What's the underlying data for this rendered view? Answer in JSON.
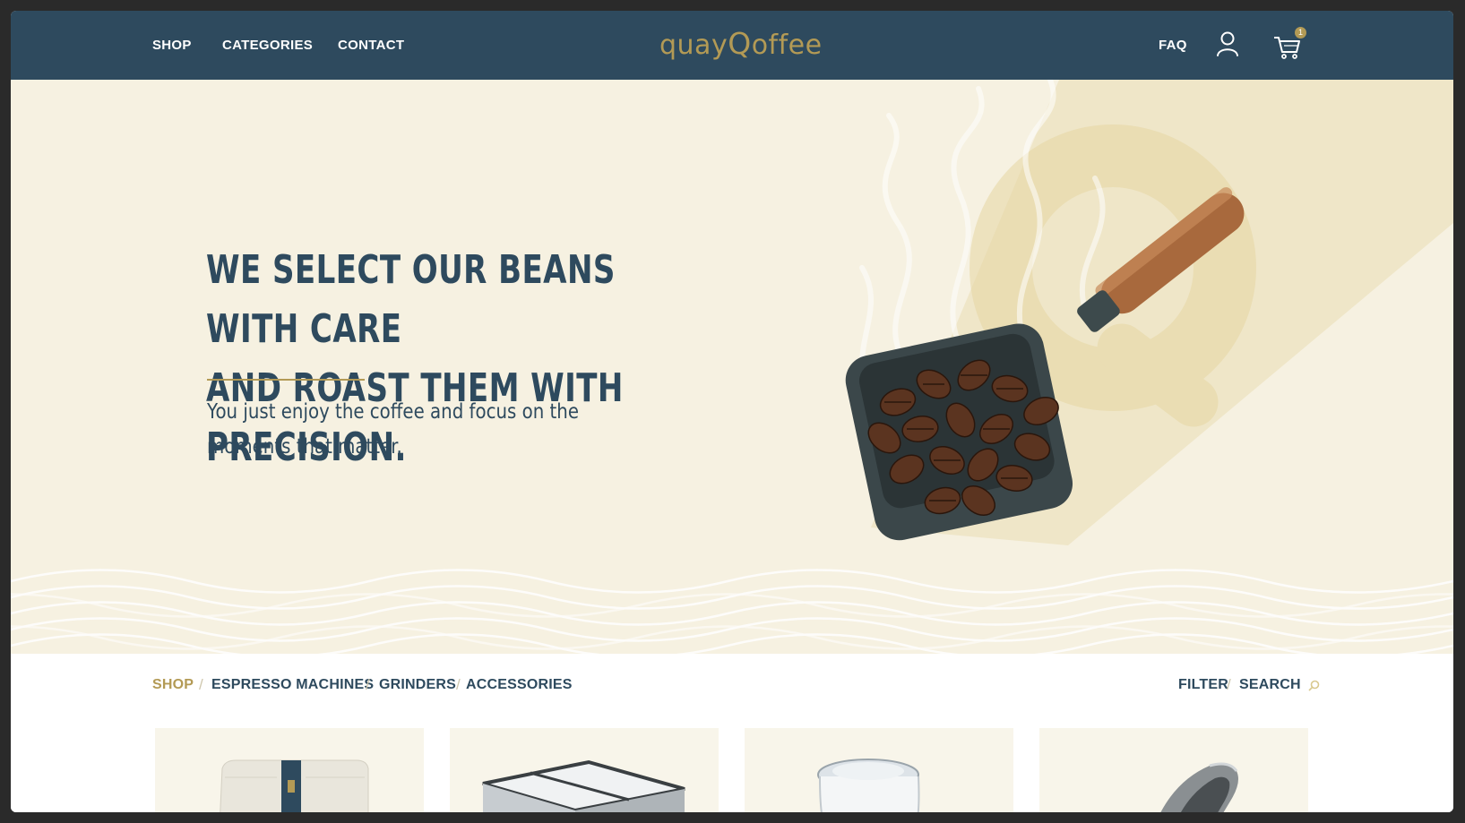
{
  "colors": {
    "navy": "#2e4a5e",
    "gold": "#b39a55",
    "cream": "#f6f1e1"
  },
  "header": {
    "nav": {
      "shop": "SHOP",
      "categories": "CATEGORIES",
      "contact": "CONTACT",
      "faq": "FAQ"
    },
    "logo": {
      "prefix": "quay",
      "mark": "Q",
      "suffix": "offee"
    },
    "icons": {
      "account": "user-icon",
      "cart": "cart-icon"
    },
    "cart_count": "1"
  },
  "hero": {
    "title_line1": "WE SELECT OUR BEANS WITH CARE",
    "title_line2": "AND ROAST THEM WITH PRECISION.",
    "subtitle_line1": "You just enjoy the coffee and focus on the",
    "subtitle_line2": "moments that matter."
  },
  "shop": {
    "categories": [
      "SHOP",
      "ESPRESSO MACHINES",
      "GRINDERS",
      "ACCESSORIES"
    ],
    "filter": "FILTER",
    "search": "SEARCH",
    "products": [
      {
        "image": "coffee-bag"
      },
      {
        "image": "knock-box"
      },
      {
        "image": "milk-pitcher"
      },
      {
        "image": "tamper"
      }
    ]
  }
}
